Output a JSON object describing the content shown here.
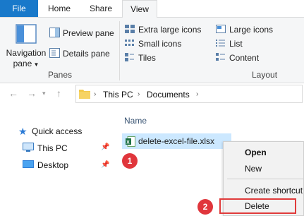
{
  "ribbon": {
    "tabs": {
      "file": "File",
      "home": "Home",
      "share": "Share",
      "view": "View"
    },
    "panes": {
      "navigation_pane_line1": "Navigation",
      "navigation_pane_line2": "pane",
      "preview_pane": "Preview pane",
      "details_pane": "Details pane",
      "group_label": "Panes"
    },
    "layout": {
      "extra_large_icons": "Extra large icons",
      "large_icons": "Large icons",
      "small_icons": "Small icons",
      "list": "List",
      "tiles": "Tiles",
      "content": "Content",
      "group_label": "Layout"
    }
  },
  "address": {
    "crumbs": [
      "This PC",
      "Documents"
    ]
  },
  "nav": {
    "quick_access": "Quick access",
    "this_pc": "This PC",
    "desktop": "Desktop"
  },
  "files": {
    "column_name": "Name",
    "items": [
      {
        "name": "delete-excel-file.xlsx"
      }
    ]
  },
  "context_menu": {
    "open": "Open",
    "new": "New",
    "create_shortcut": "Create shortcut",
    "delete": "Delete"
  },
  "annotations": {
    "step1": "1",
    "step2": "2"
  },
  "colors": {
    "accent": "#1979ca",
    "selection": "#cce8ff",
    "highlight_red": "#e03b3b"
  }
}
